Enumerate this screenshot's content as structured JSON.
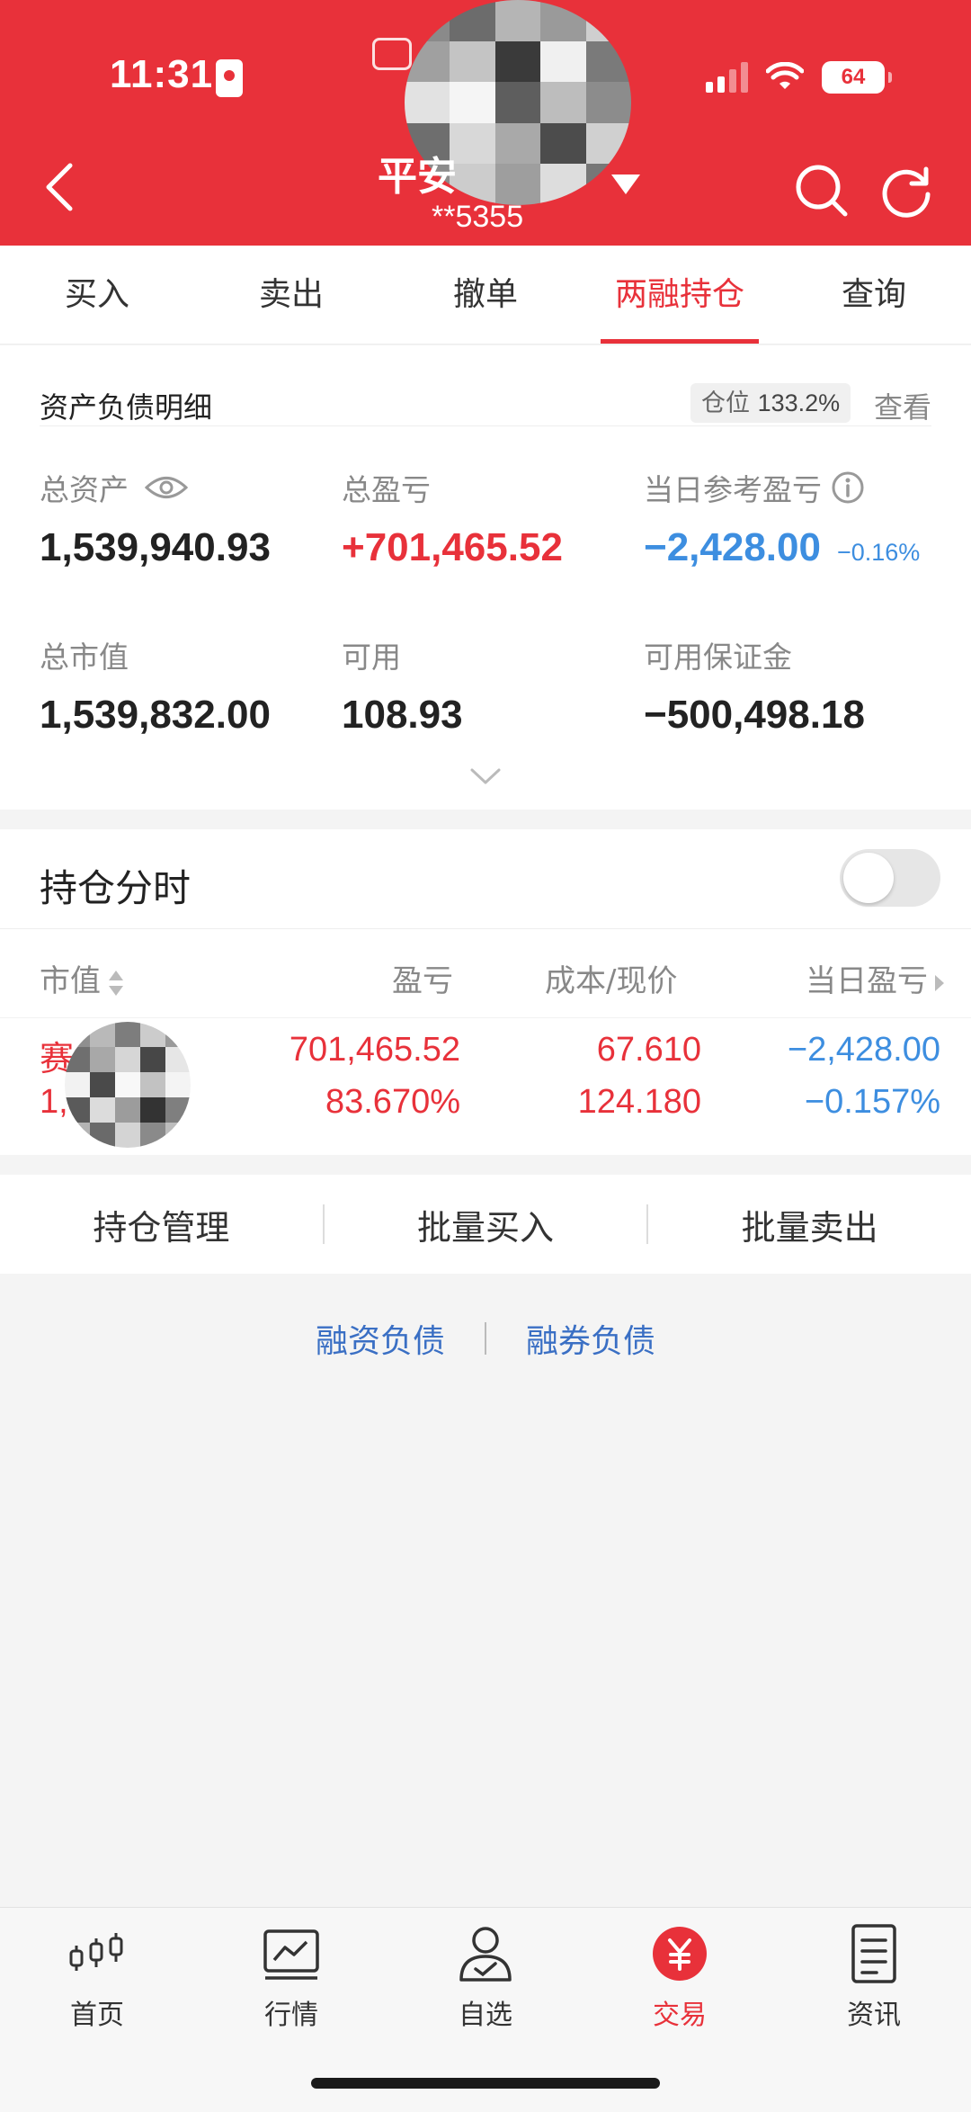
{
  "status_bar": {
    "time": "11:31",
    "battery": "64"
  },
  "nav": {
    "title": "平安",
    "account": "**5355"
  },
  "tabs": [
    {
      "label": "买入",
      "active": false
    },
    {
      "label": "卖出",
      "active": false
    },
    {
      "label": "撤单",
      "active": false
    },
    {
      "label": "两融持仓",
      "active": true
    },
    {
      "label": "查询",
      "active": false
    }
  ],
  "asset": {
    "title": "资产负债明细",
    "position_label": "仓位",
    "position_value": "133.2%",
    "view_label": "查看",
    "total_assets_label": "总资产",
    "total_assets": "1,539,940.93",
    "total_pl_label": "总盈亏",
    "total_pl": "+701,465.52",
    "day_pl_label": "当日参考盈亏",
    "day_pl": "−2,428.00",
    "day_pl_pct": "−0.16%",
    "market_value_label": "总市值",
    "market_value": "1,539,832.00",
    "available_label": "可用",
    "available": "108.93",
    "margin_label": "可用保证金",
    "margin": "−500,498.18"
  },
  "holdings": {
    "title": "持仓分时",
    "toggle_on": false,
    "columns": {
      "market_value": "市值",
      "pl": "盈亏",
      "cost_price": "成本/现价",
      "day_pl": "当日盈亏"
    },
    "rows": [
      {
        "name": "赛",
        "market_value": "1,5  2.00",
        "pl": "701,465.52",
        "pl_pct": "83.670%",
        "cost": "67.610",
        "price": "124.180",
        "day_pl": "−2,428.00",
        "day_pl_pct": "−0.157%"
      }
    ]
  },
  "actions": [
    "持仓管理",
    "批量买入",
    "批量卖出"
  ],
  "links": [
    "融资负债",
    "融券负债"
  ],
  "bottom_nav": [
    {
      "label": "首页",
      "icon": "candlestick-icon",
      "active": false
    },
    {
      "label": "行情",
      "icon": "chart-icon",
      "active": false
    },
    {
      "label": "自选",
      "icon": "user-check-icon",
      "active": false
    },
    {
      "label": "交易",
      "icon": "yuan-icon",
      "active": true
    },
    {
      "label": "资讯",
      "icon": "document-icon",
      "active": false
    }
  ],
  "colors": {
    "brand_red": "#e8313a",
    "loss_blue": "#3d8ee0",
    "link_blue": "#3a6fc4"
  }
}
